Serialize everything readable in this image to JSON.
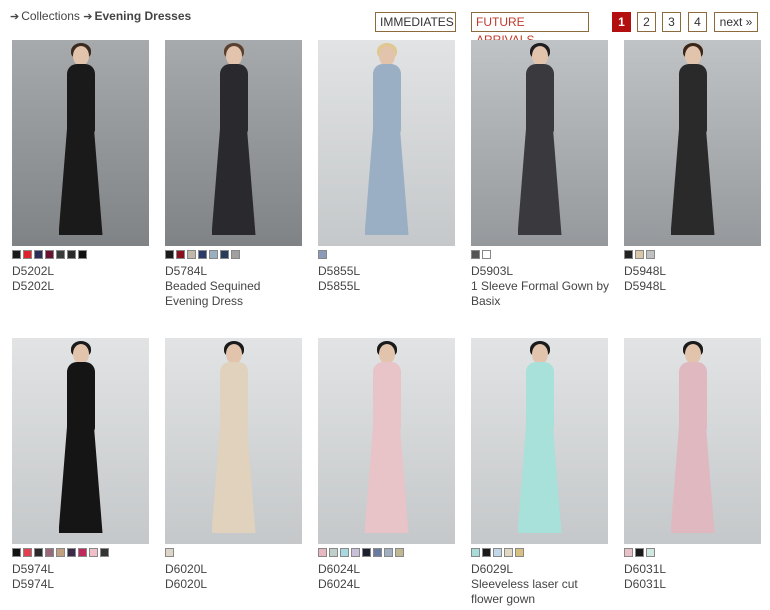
{
  "breadcrumb": {
    "arrow": "➔",
    "parent": "Collections",
    "current": "Evening Dresses"
  },
  "filters": {
    "immediates": "IMMEDIATES",
    "future": "FUTURE ARRIVALS"
  },
  "pagination": {
    "pages": [
      "1",
      "2",
      "3",
      "4"
    ],
    "active": "1",
    "next": "next »"
  },
  "products": [
    {
      "code": "D5202L",
      "name": "D5202L",
      "photo": "dark",
      "dress": "#1a1a1a",
      "hair": "#3a2a20",
      "swatches": [
        "#1a1a1a",
        "#e0202a",
        "#2a2e56",
        "#6a1030",
        "#3a3a3a",
        "#2a2a2a",
        "#111111"
      ]
    },
    {
      "code": "D5784L",
      "name": "Beaded Sequined Evening Dress",
      "photo": "dark",
      "dress": "#2a2a2e",
      "hair": "#5a4030",
      "swatches": [
        "#1a1a1a",
        "#8a1020",
        "#c0b8a8",
        "#2a3a6a",
        "#9ab0c0",
        "#2a3a5a",
        "#a0a0a0"
      ]
    },
    {
      "code": "D5855L",
      "name": "D5855L",
      "photo": "light",
      "dress": "#9aaec4",
      "hair": "#e0c890",
      "swatches": [
        "#8a9ab8"
      ]
    },
    {
      "code": "D5903L",
      "name": "1 Sleeve Formal Gown by Basix",
      "photo": "mid",
      "dress": "#3a3a3e",
      "hair": "#1e1e1e",
      "swatches": [
        "#555555",
        "#ffffff"
      ]
    },
    {
      "code": "D5948L",
      "name": "D5948L",
      "photo": "mid",
      "dress": "#2a2a2a",
      "hair": "#3a2618",
      "swatches": [
        "#222222",
        "#d8c8a8",
        "#c0c0c0"
      ]
    },
    {
      "code": "D5974L",
      "name": "D5974L",
      "photo": "light",
      "dress": "#151515",
      "hair": "#1a1a1a",
      "swatches": [
        "#111111",
        "#e04050",
        "#2a2a2a",
        "#9a6a7a",
        "#c0a080",
        "#3a2a4a",
        "#c02a5a",
        "#f0c0c8",
        "#333333"
      ]
    },
    {
      "code": "D6020L",
      "name": "D6020L",
      "photo": "light",
      "dress": "#e0d2bc",
      "hair": "#1a1a1a",
      "swatches": [
        "#ddd5c8"
      ]
    },
    {
      "code": "D6024L",
      "name": "D6024L",
      "photo": "light",
      "dress": "#e8c4c8",
      "hair": "#1a1a1a",
      "swatches": [
        "#e8b8c0",
        "#c0d0c8",
        "#a8d8e0",
        "#c8c0d8",
        "#1a2030",
        "#6a7aa0",
        "#a0b0c0",
        "#c0b890"
      ]
    },
    {
      "code": "D6029L",
      "name": "Sleeveless laser cut flower gown",
      "photo": "light",
      "dress": "#a8e0da",
      "hair": "#1a1a1a",
      "swatches": [
        "#a8dcd8",
        "#1a1a1a",
        "#c0d8e8",
        "#e0d8c0",
        "#d8c080"
      ]
    },
    {
      "code": "D6031L",
      "name": "D6031L",
      "photo": "light",
      "dress": "#e0b8c0",
      "hair": "#1a1a1a",
      "swatches": [
        "#e8c0c8",
        "#1a1a1a",
        "#d0e8e0"
      ]
    }
  ]
}
